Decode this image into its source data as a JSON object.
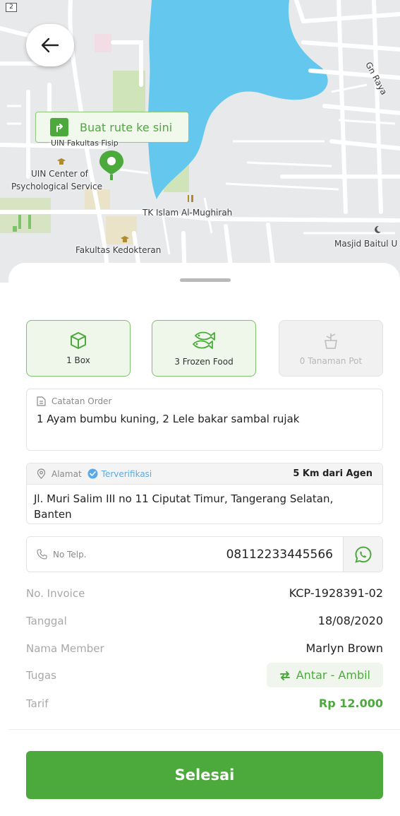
{
  "map": {
    "corner_tag": "2",
    "route_button": "Buat rute ke sini",
    "labels": {
      "fisip": "UIN Fakultas Fisip",
      "center_line1": "UIN Center of",
      "center_line2": "Psychological Service",
      "tk": "TK Islam Al-Mughirah",
      "kedokteran": "Fakultas Kedokteran",
      "masjid": "Masjid Baitul U",
      "gn_raya": "Gn Raya"
    }
  },
  "categories": [
    {
      "label": "1 Box",
      "icon": "box-icon",
      "active": true
    },
    {
      "label": "3 Frozen Food",
      "icon": "fish-icon",
      "active": true
    },
    {
      "label": "0 Tanaman Pot",
      "icon": "plant-pot-icon",
      "active": false
    }
  ],
  "order_note": {
    "label": "Catatan Order",
    "text": "1 Ayam bumbu kuning, 2 Lele bakar sambal rujak"
  },
  "address": {
    "label": "Alamat",
    "verified": "Terverifikasi",
    "distance": "5 Km dari Agen",
    "line1": "Jl. Muri Salim III no 11 Ciputat Timur, Tangerang Selatan,",
    "line2": "Banten"
  },
  "phone": {
    "label": "No Telp.",
    "number": "08112233445566"
  },
  "details": {
    "invoice_label": "No. Invoice",
    "invoice_value": "KCP-1928391-02",
    "date_label": "Tanggal",
    "date_value": "18/08/2020",
    "member_label": "Nama Member",
    "member_value": "Marlyn Brown",
    "task_label": "Tugas",
    "task_value": "Antar - Ambil",
    "tarif_label": "Tarif",
    "tarif_value": "Rp 12.000"
  },
  "done_button": "Selesai",
  "colors": {
    "accent": "#4caa3c",
    "water": "#64c8ee",
    "verified": "#5aa9e6"
  }
}
